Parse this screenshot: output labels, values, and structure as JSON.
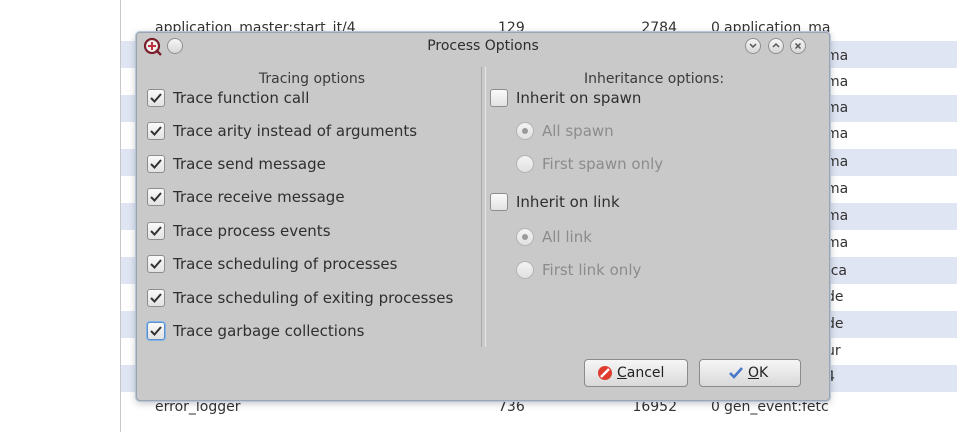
{
  "background_table": {
    "rows": [
      {
        "name": "application_master:start_it/4",
        "reds": "129",
        "memory": "2784",
        "mq": "0",
        "current": "application_ma"
      },
      {
        "name": "",
        "reds": "",
        "memory": "",
        "mq": "",
        "current": ""
      },
      {
        "name": "",
        "reds": "",
        "memory": "",
        "mq": "",
        "current": ""
      },
      {
        "name": "",
        "reds": "",
        "memory": "",
        "mq": "",
        "current": ""
      },
      {
        "name": "",
        "reds": "",
        "memory": "",
        "mq": "",
        "current": ""
      },
      {
        "name": "",
        "reds": "",
        "memory": "",
        "mq": "",
        "current": ""
      },
      {
        "name": "",
        "reds": "",
        "memory": "",
        "mq": "",
        "current": ""
      },
      {
        "name": "",
        "reds": "",
        "memory": "",
        "mq": "",
        "current": ""
      },
      {
        "name": "",
        "reds": "",
        "memory": "",
        "mq": "",
        "current": ""
      },
      {
        "name": "",
        "reds": "",
        "memory": "",
        "mq": "",
        "current": ""
      },
      {
        "name": "",
        "reds": "",
        "memory": "",
        "mq": "",
        "current": ""
      },
      {
        "name": "",
        "reds": "",
        "memory": "",
        "mq": "",
        "current": ""
      },
      {
        "name": "",
        "reds": "",
        "memory": "",
        "mq": "",
        "current": ""
      },
      {
        "name": "",
        "reds": "",
        "memory": "",
        "mq": "",
        "current": ""
      },
      {
        "name": "error_logger",
        "reds": "736",
        "memory": "16952",
        "mq": "0",
        "current": "gen_event:fetc"
      }
    ],
    "right_fragments": [
      "ma",
      "ma",
      "ma",
      "ma",
      "ma",
      "ma",
      "ma",
      "ma",
      ":ca",
      "de",
      "de",
      "ur",
      "4"
    ]
  },
  "dialog": {
    "title": "Process Options",
    "left_panel": {
      "heading": "Tracing options",
      "options": [
        {
          "label": "Trace function call",
          "checked": true
        },
        {
          "label": "Trace arity instead of arguments",
          "checked": true
        },
        {
          "label": "Trace send message",
          "checked": true
        },
        {
          "label": "Trace receive message",
          "checked": true
        },
        {
          "label": "Trace process events",
          "checked": true
        },
        {
          "label": "Trace scheduling of processes",
          "checked": true
        },
        {
          "label": "Trace scheduling of exiting processes",
          "checked": true
        },
        {
          "label": "Trace garbage collections",
          "checked": true
        }
      ]
    },
    "right_panel": {
      "heading": "Inheritance options:",
      "inherit_spawn": {
        "label": "Inherit on spawn",
        "checked": false
      },
      "spawn_radios": [
        {
          "label": "All spawn",
          "selected": true
        },
        {
          "label": "First spawn only",
          "selected": false
        }
      ],
      "inherit_link": {
        "label": "Inherit on link",
        "checked": false
      },
      "link_radios": [
        {
          "label": "All link",
          "selected": true
        },
        {
          "label": "First link only",
          "selected": false
        }
      ]
    },
    "buttons": {
      "cancel": {
        "label_underlined": "C",
        "label_rest": "ancel"
      },
      "ok": {
        "label_underlined": "O",
        "label_rest": "K"
      }
    },
    "colors": {
      "dialog_bg": "#c9c9c9",
      "row_alt": "#dfe5f3",
      "focus": "#5a90cf",
      "cancel_icon": "#e03b2f",
      "ok_icon": "#4a78c9"
    }
  }
}
